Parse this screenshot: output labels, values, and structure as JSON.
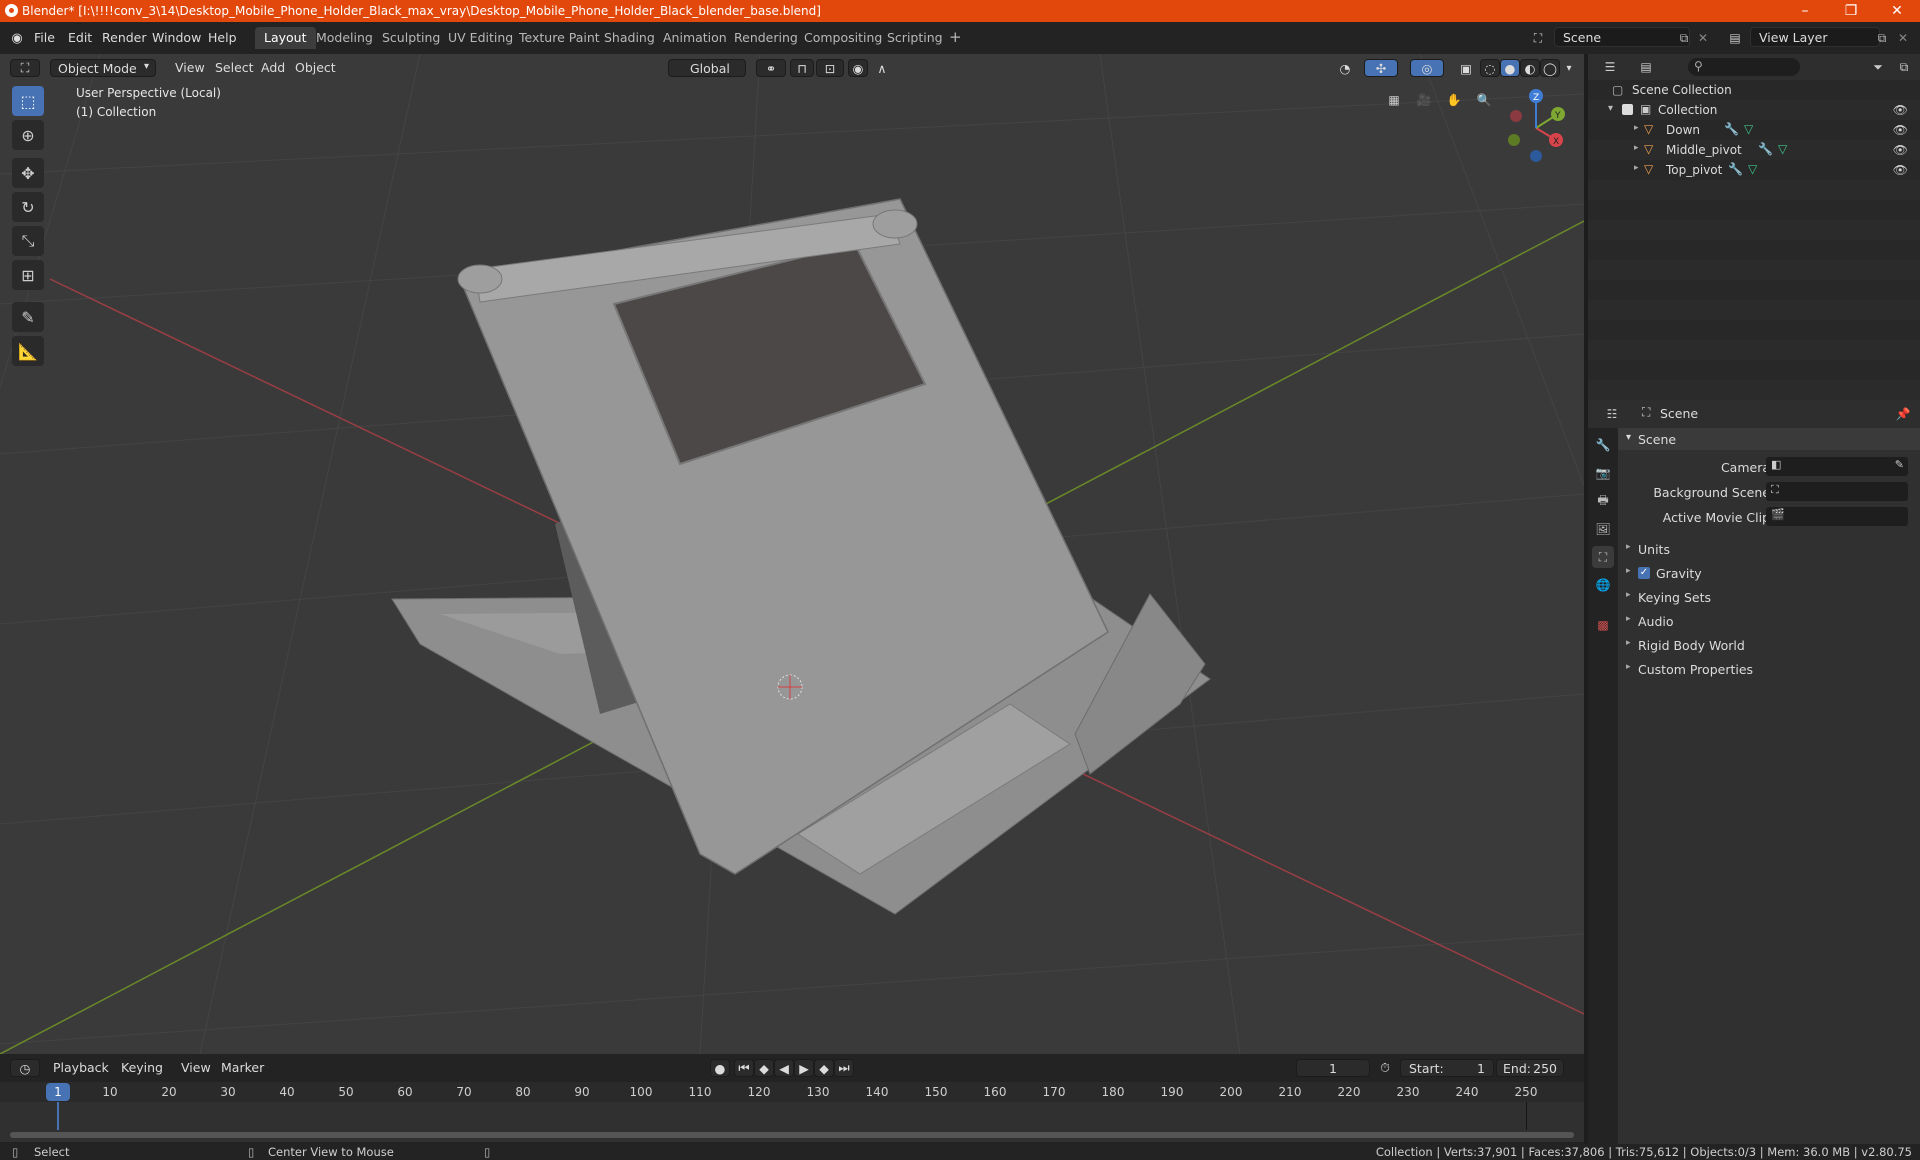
{
  "window": {
    "title": "Blender* [I:\\!!!!conv_3\\14\\Desktop_Mobile_Phone_Holder_Black_max_vray\\Desktop_Mobile_Phone_Holder_Black_blender_base.blend]",
    "minimize": "–",
    "restore": "❐",
    "close": "✕"
  },
  "menubar": {
    "items": [
      "File",
      "Edit",
      "Render",
      "Window",
      "Help"
    ],
    "workspaces": [
      "Layout",
      "Modeling",
      "Sculpting",
      "UV Editing",
      "Texture Paint",
      "Shading",
      "Animation",
      "Rendering",
      "Compositing",
      "Scripting"
    ],
    "add_tab": "+",
    "scene_value": "Scene",
    "view_layer_value": "View Layer"
  },
  "viewport": {
    "mode": "Object Mode",
    "menus": [
      "View",
      "Select",
      "Add",
      "Object"
    ],
    "orientation": "Global",
    "perspective_label": "User Perspective (Local)",
    "collection_label": "(1) Collection",
    "gizmo": {
      "x": "X",
      "y": "Y",
      "z": "Z"
    }
  },
  "outliner": {
    "root": "Scene Collection",
    "collection": "Collection",
    "objects": [
      "Down",
      "Middle_pivot",
      "Top_pivot"
    ]
  },
  "properties": {
    "header": "Scene",
    "panel_title": "Scene",
    "fields": [
      {
        "label": "Camera"
      },
      {
        "label": "Background Scene"
      },
      {
        "label": "Active Movie Clip"
      }
    ],
    "sections": [
      "Units",
      "Gravity",
      "Keying Sets",
      "Audio",
      "Rigid Body World",
      "Custom Properties"
    ]
  },
  "timeline": {
    "menus": [
      "Playback",
      "Keying",
      "View",
      "Marker"
    ],
    "current_frame": "1",
    "start_label": "Start:",
    "start_value": "1",
    "end_label": "End:",
    "end_value": "250",
    "ruler": [
      "1",
      "10",
      "20",
      "30",
      "40",
      "50",
      "60",
      "70",
      "80",
      "90",
      "100",
      "110",
      "120",
      "130",
      "140",
      "150",
      "160",
      "170",
      "180",
      "190",
      "200",
      "210",
      "220",
      "230",
      "240",
      "250"
    ]
  },
  "statusbar": {
    "select": "Select",
    "center": "Center View to Mouse",
    "stats": "Collection | Verts:37,901 | Faces:37,806 | Tris:75,612 | Objects:0/3 | Mem: 36.0 MB | v2.80.75"
  },
  "colors": {
    "titlebar": "#e2480c",
    "accent": "#4772b3",
    "x_axis": "#d8444c",
    "y_axis": "#7fa832",
    "z_axis": "#3f7cd5",
    "mesh_orange": "#f0a050"
  }
}
